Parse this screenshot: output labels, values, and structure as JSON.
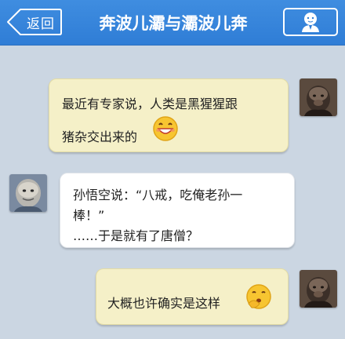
{
  "header": {
    "back_label": "返回",
    "title": "奔波儿灞与灞波儿奔",
    "profile_icon": "person-icon"
  },
  "colors": {
    "header_bg": "#3a87dc",
    "chat_bg": "#cbd6e2",
    "sent_bubble": "#f5f0c8",
    "received_bubble": "#ffffff"
  },
  "messages": [
    {
      "side": "right",
      "lines": [
        "最近有专家说，人类是黑猩猩跟",
        "猪杂交出来的"
      ],
      "emoji": "grinning-emoji-icon"
    },
    {
      "side": "left",
      "lines": [
        "孙悟空说：“八戒，吃俺老孙一",
        "棒！”",
        "……于是就有了唐僧？"
      ]
    },
    {
      "side": "right",
      "lines": [
        "大概也许确实是这样"
      ],
      "emoji": "thinking-emoji-icon"
    }
  ]
}
